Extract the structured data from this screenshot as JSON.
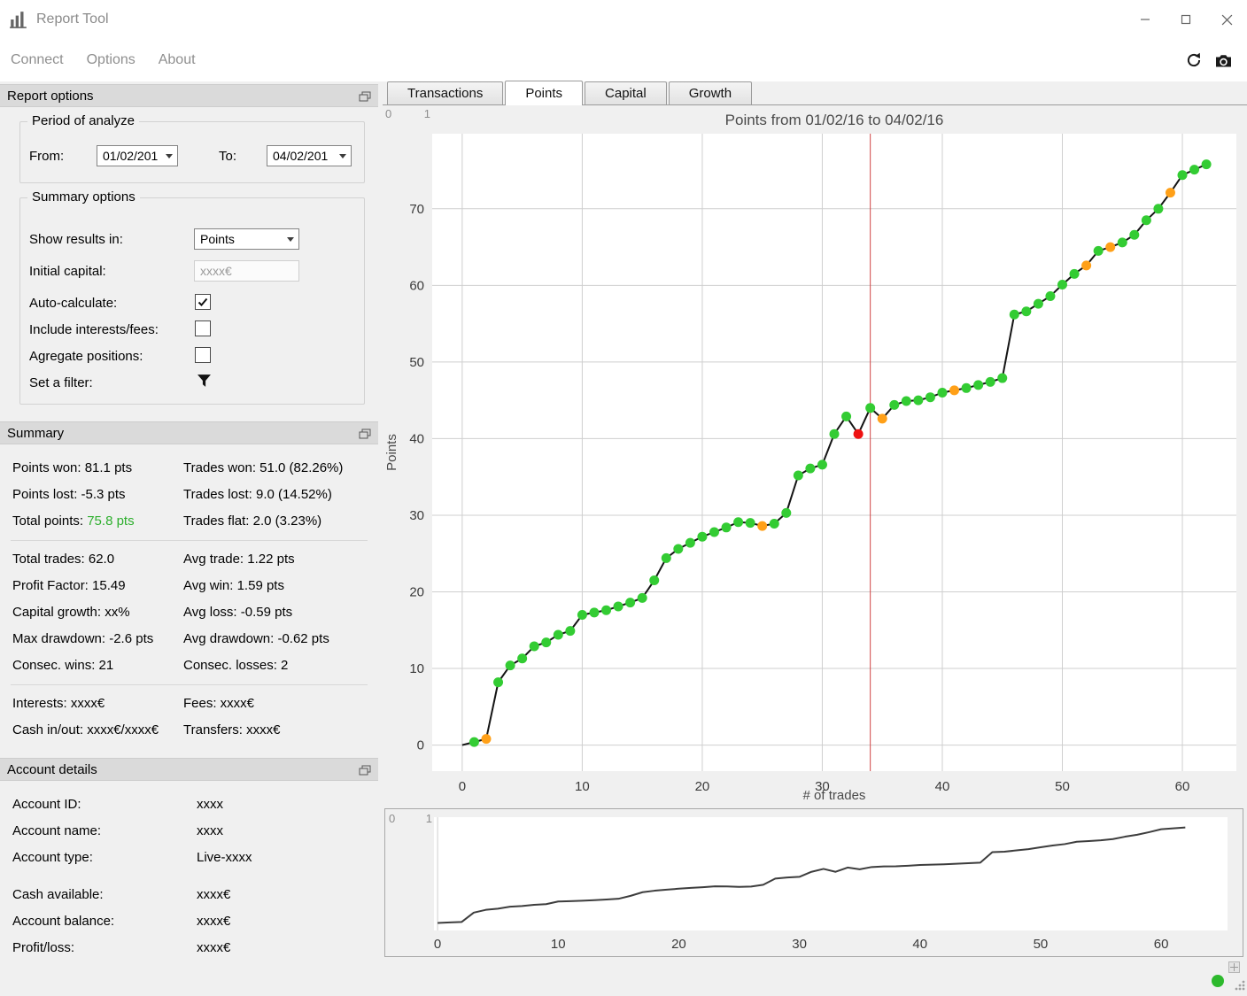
{
  "window": {
    "title": "Report Tool",
    "menu_items": [
      "Connect",
      "Options",
      "About"
    ]
  },
  "panels": {
    "report_options": {
      "header": "Report options",
      "period_group_label": "Period of analyze",
      "from_label": "From:",
      "from_value": "01/02/201",
      "to_label": "To:",
      "to_value": "04/02/201",
      "summary_group_label": "Summary options",
      "show_results_label": "Show results in:",
      "show_results_value": "Points",
      "initial_capital_label": "Initial capital:",
      "initial_capital_value": "xxxx€",
      "auto_calculate_label": "Auto-calculate:",
      "auto_calculate_checked": true,
      "include_fees_label": "Include interests/fees:",
      "include_fees_checked": false,
      "agregate_label": "Agregate positions:",
      "agregate_checked": false,
      "filter_label": "Set a filter:"
    },
    "summary": {
      "header": "Summary",
      "points_won": "Points won: 81.1 pts",
      "trades_won": "Trades won: 51.0 (82.26%)",
      "points_lost": "Points lost: -5.3 pts",
      "trades_lost": "Trades lost: 9.0 (14.52%)",
      "total_points_label": "Total points:",
      "total_points_value": "75.8 pts",
      "total_points_color": "#2eaf2e",
      "trades_flat": "Trades flat: 2.0 (3.23%)",
      "total_trades": "Total trades: 62.0",
      "avg_trade": "Avg trade: 1.22 pts",
      "profit_factor": "Profit Factor: 15.49",
      "avg_win": "Avg win: 1.59 pts",
      "capital_growth": "Capital growth: xx%",
      "avg_loss": "Avg loss: -0.59 pts",
      "max_drawdown": "Max drawdown: -2.6 pts",
      "avg_drawdown": "Avg drawdown: -0.62 pts",
      "consec_wins": "Consec. wins: 21",
      "consec_losses": "Consec. losses: 2",
      "interests": "Interests: xxxx€",
      "fees": "Fees: xxxx€",
      "cash_in_out": "Cash in/out: xxxx€/xxxx€",
      "transfers": "Transfers: xxxx€"
    },
    "account": {
      "header": "Account details",
      "rows": [
        {
          "label": "Account ID:",
          "value": "xxxx"
        },
        {
          "label": "Account name:",
          "value": "xxxx"
        },
        {
          "label": "Account type:",
          "value": "Live-xxxx"
        },
        {
          "label": "Cash available:",
          "value": "xxxx€"
        },
        {
          "label": "Account balance:",
          "value": "xxxx€"
        },
        {
          "label": "Profit/loss:",
          "value": "xxxx€"
        }
      ]
    }
  },
  "tabs": [
    {
      "label": "Transactions",
      "active": false
    },
    {
      "label": "Points",
      "active": true
    },
    {
      "label": "Capital",
      "active": false
    },
    {
      "label": "Growth",
      "active": false
    }
  ],
  "chart_data": {
    "type": "line",
    "title": "Points from 01/02/16 to 04/02/16",
    "xlabel": "# of trades",
    "ylabel": "Points",
    "x_description": "trade index 0..62, one cumulative value per trade",
    "y": [
      0,
      0.4,
      0.8,
      8.2,
      10.4,
      11.3,
      12.9,
      13.4,
      14.4,
      14.9,
      17.0,
      17.3,
      17.6,
      18.1,
      18.6,
      19.2,
      21.5,
      24.4,
      25.6,
      26.4,
      27.2,
      27.8,
      28.4,
      29.1,
      29.0,
      28.6,
      28.9,
      30.3,
      35.2,
      36.1,
      36.6,
      40.6,
      42.9,
      40.6,
      44.0,
      42.6,
      44.4,
      44.9,
      45.0,
      45.4,
      46.0,
      46.3,
      46.6,
      47.0,
      47.4,
      47.9,
      56.2,
      56.6,
      57.6,
      58.6,
      60.1,
      61.5,
      62.6,
      64.5,
      65.0,
      65.6,
      66.6,
      68.5,
      70.0,
      72.1,
      74.4,
      75.1,
      75.8
    ],
    "marker_colors": [
      "",
      "g",
      "o",
      "g",
      "g",
      "g",
      "g",
      "g",
      "g",
      "g",
      "g",
      "g",
      "g",
      "g",
      "g",
      "g",
      "g",
      "g",
      "g",
      "g",
      "g",
      "g",
      "g",
      "g",
      "g",
      "o",
      "g",
      "g",
      "g",
      "g",
      "g",
      "g",
      "g",
      "r",
      "g",
      "o",
      "g",
      "g",
      "g",
      "g",
      "g",
      "o",
      "g",
      "g",
      "g",
      "g",
      "g",
      "g",
      "g",
      "g",
      "g",
      "g",
      "o",
      "g",
      "o",
      "g",
      "g",
      "g",
      "g",
      "o",
      "g",
      "g",
      "g"
    ],
    "color_map": {
      "g": "#33cc33",
      "o": "#ffa018",
      "r": "#ee1111"
    },
    "line_color": "#141414",
    "cursor_x": 34,
    "cursor_color": "#d04545",
    "grid_color": "#cfcfcf",
    "plot_bg": "#ffffff",
    "main_axes": {
      "xlim": [
        -2.5,
        64.5
      ],
      "ylim": [
        -3.4,
        79.8
      ],
      "xticks": [
        0,
        10,
        20,
        30,
        40,
        50,
        60
      ],
      "yticks": [
        0,
        10,
        20,
        30,
        40,
        50,
        60,
        70
      ],
      "grid": true
    },
    "mini_axes": {
      "xlim": [
        -0.3,
        65.5
      ],
      "ylim": [
        -6,
        84
      ],
      "xticks": [
        0,
        10,
        20,
        30,
        40,
        50,
        60
      ],
      "line_color": "#3d3d3d"
    },
    "corner_labels": [
      "0",
      "1"
    ]
  },
  "status": {
    "connected_color": "#2db92d"
  }
}
